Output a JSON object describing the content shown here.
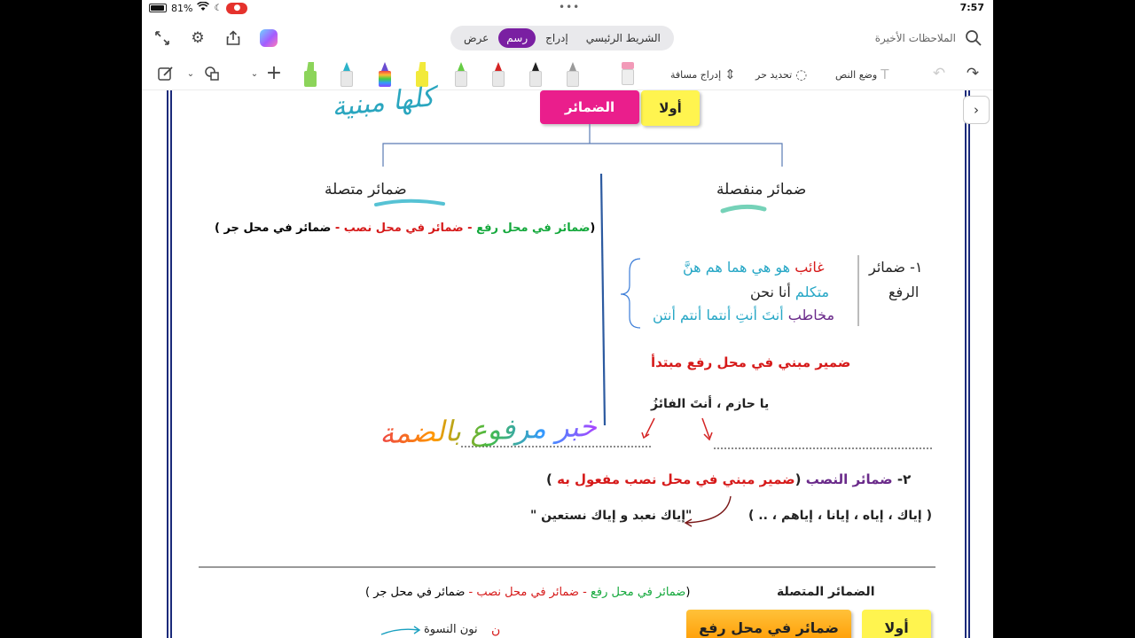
{
  "status_bar": {
    "battery": "81%",
    "time": "7:57"
  },
  "top_toolbar": {
    "tabs": [
      {
        "label": "الشريط الرئيسي"
      },
      {
        "label": "إدراج"
      },
      {
        "label": "رسم"
      },
      {
        "label": "عرض"
      }
    ],
    "recent_notes": "الملاحظات الأخيرة"
  },
  "draw_toolbar": {
    "insert_space": "إدراج مسافة",
    "lasso_select": "تحديد حر",
    "text_mode": "وضع النص",
    "pens": [
      {
        "name": "highlighter-green",
        "color": "#8cd45a"
      },
      {
        "name": "pen-teal",
        "color": "#2cb3c9"
      },
      {
        "name": "pen-rainbow",
        "color": "#6a4cd0"
      },
      {
        "name": "highlighter-yellow",
        "color": "#f2ea3a"
      },
      {
        "name": "pen-lightgreen",
        "color": "#66cc44"
      },
      {
        "name": "pen-red",
        "color": "#d42323"
      },
      {
        "name": "pen-black",
        "color": "#222222"
      },
      {
        "name": "pencil-gray",
        "color": "#9a9a9a"
      },
      {
        "name": "eraser-pink",
        "color": "#f29ab8"
      }
    ]
  },
  "note": {
    "first_box": "أولا",
    "pronouns_box": "الضمائر",
    "handwriting_top": "كلها مبنية",
    "connected_heading": "ضمائر متصلة",
    "separate_heading": "ضمائر منفصلة",
    "connected_types": {
      "open": "(",
      "raf": "ضمائر في محل رفع",
      "dash1": "-",
      "nasb": "ضمائر في محل نصب",
      "dash2": "-",
      "jarr": "ضمائر في محل جر )"
    },
    "raf_label_line1": "١- ضمائر",
    "raf_label_line2": "الرفع",
    "rows": [
      {
        "label": "غائب",
        "words": "هو هي هما هم هنَّ"
      },
      {
        "label": "متكلم",
        "words": "أنا   نحن"
      },
      {
        "label": "مخاطب",
        "words": "أنتَ أنتِ أنتما أنتم أنتن"
      }
    ],
    "mubtada_note": "ضمير مبني في محل رفع مبتدأ",
    "example": "يا حازم ، أنتَ الفائزُ",
    "handwriting_khabar": "خبر مرفوع بالضمة",
    "nasb_number": "٢-",
    "nasb_title": "ضمائر النصب",
    "nasb_paren_open": "(",
    "nasb_note": "ضمير مبني في محل نصب مفعول به",
    "nasb_paren_close": ")",
    "nasb_list": "( إياك ، إياه ، إيانا ، إياهم ، .. )",
    "quran_quote": "\"إياك نعبد و إياك نستعين \"",
    "bottom_title": "الضمائر المتصلة",
    "bottom_types": {
      "open": "(",
      "raf": "ضمائر في محل رفع",
      "dash1": "-",
      "nasb": "ضمائر في محل نصب",
      "dash2": "-",
      "jarr": "ضمائر في محل جر )"
    },
    "bottom_first_box": "أولا",
    "bottom_raf_box": "ضمائر في محل رفع",
    "noon_letter": "ن",
    "noon_label": "نون النسوة"
  }
}
